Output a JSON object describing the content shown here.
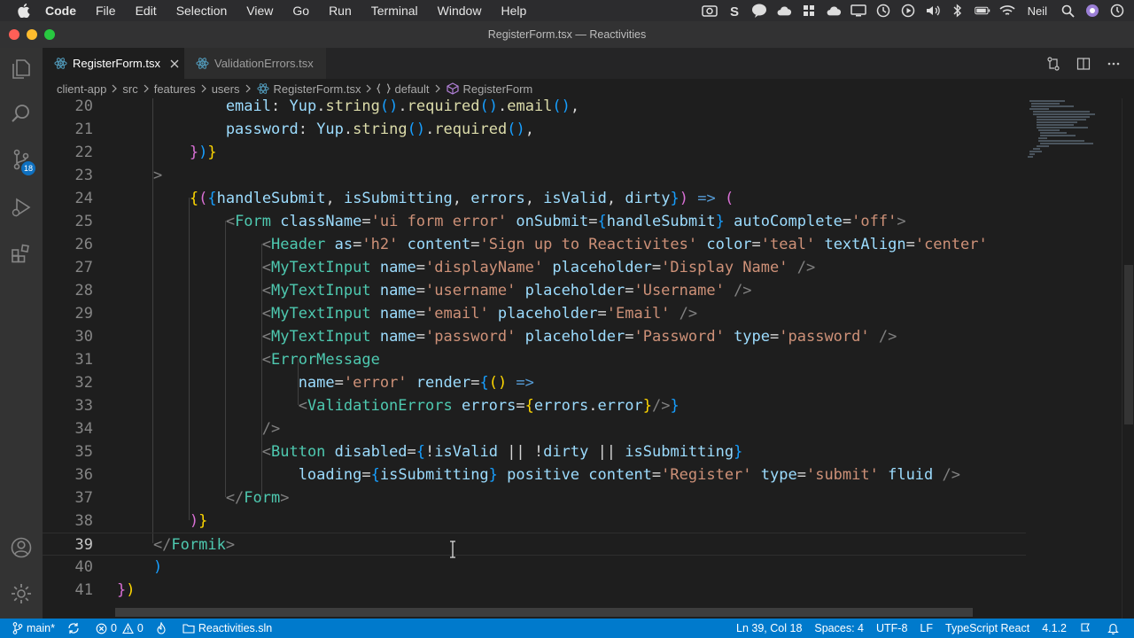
{
  "menubar": {
    "app_name": "Code",
    "items": [
      "File",
      "Edit",
      "Selection",
      "View",
      "Go",
      "Run",
      "Terminal",
      "Window",
      "Help"
    ],
    "user": "Neil"
  },
  "window": {
    "title": "RegisterForm.tsx — Reactivities"
  },
  "activity_bar": {
    "source_control_badge": "18"
  },
  "tabs": [
    {
      "label": "RegisterForm.tsx",
      "active": true
    },
    {
      "label": "ValidationErrors.tsx",
      "active": false
    }
  ],
  "breadcrumb": [
    "client-app",
    "src",
    "features",
    "users",
    "RegisterForm.tsx",
    "default",
    "RegisterForm"
  ],
  "editor": {
    "current_line": 39,
    "lines": [
      {
        "n": "20",
        "t": "            email: Yup.string().required().email(),"
      },
      {
        "n": "21",
        "t": "            password: Yup.string().required(),"
      },
      {
        "n": "22",
        "t": "        })}"
      },
      {
        "n": "23",
        "t": "    >"
      },
      {
        "n": "24",
        "t": "        {({handleSubmit, isSubmitting, errors, isValid, dirty}) => ("
      },
      {
        "n": "25",
        "t": "            <Form className='ui form error' onSubmit={handleSubmit} autoComplete='off'>"
      },
      {
        "n": "26",
        "t": "                <Header as='h2' content='Sign up to Reactivites' color='teal' textAlign='center'"
      },
      {
        "n": "27",
        "t": "                <MyTextInput name='displayName' placeholder='Display Name' />"
      },
      {
        "n": "28",
        "t": "                <MyTextInput name='username' placeholder='Username' />"
      },
      {
        "n": "29",
        "t": "                <MyTextInput name='email' placeholder='Email' />"
      },
      {
        "n": "30",
        "t": "                <MyTextInput name='password' placeholder='Password' type='password' />"
      },
      {
        "n": "31",
        "t": "                <ErrorMessage"
      },
      {
        "n": "32",
        "t": "                    name='error' render={() =>"
      },
      {
        "n": "33",
        "t": "                    <ValidationErrors errors={errors.error}/>}"
      },
      {
        "n": "34",
        "t": "                />"
      },
      {
        "n": "35",
        "t": "                <Button disabled={!isValid || !dirty || isSubmitting}"
      },
      {
        "n": "36",
        "t": "                    loading={isSubmitting} positive content='Register' type='submit' fluid />"
      },
      {
        "n": "37",
        "t": "            </Form>"
      },
      {
        "n": "38",
        "t": "        )}"
      },
      {
        "n": "39",
        "t": "    </Formik>"
      },
      {
        "n": "40",
        "t": "    )"
      },
      {
        "n": "41",
        "t": "})"
      }
    ]
  },
  "statusbar": {
    "branch": "main*",
    "errors": "0",
    "warnings": "0",
    "solution": "Reactivities.sln",
    "position": "Ln 39, Col 18",
    "spaces": "Spaces: 4",
    "encoding": "UTF-8",
    "eol": "LF",
    "language": "TypeScript React",
    "ts_version": "4.1.2"
  },
  "colors": {
    "accent": "#007acc",
    "editor_bg": "#1e1e1e",
    "keyword": "#569cd6",
    "component": "#4ec9b0",
    "attribute": "#9cdcfe",
    "string": "#ce9178",
    "function": "#dcdcaa"
  }
}
